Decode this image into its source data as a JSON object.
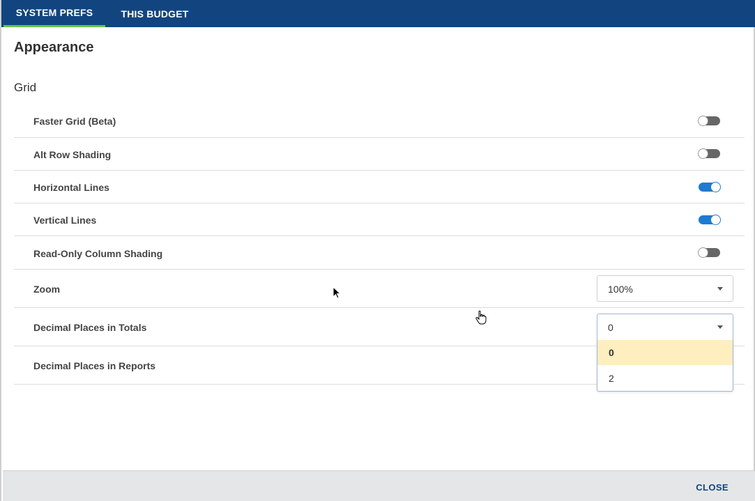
{
  "tabs": [
    {
      "label": "SYSTEM PREFS",
      "active": true
    },
    {
      "label": "THIS BUDGET",
      "active": false
    }
  ],
  "section": {
    "title": "Appearance"
  },
  "group": {
    "title": "Grid"
  },
  "toggles": [
    {
      "label": "Faster Grid (Beta)",
      "on": false
    },
    {
      "label": "Alt Row Shading",
      "on": false
    },
    {
      "label": "Horizontal Lines",
      "on": true
    },
    {
      "label": "Vertical Lines",
      "on": true
    },
    {
      "label": "Read-Only Column Shading",
      "on": false
    }
  ],
  "zoom": {
    "label": "Zoom",
    "value": "100%"
  },
  "decimals_totals": {
    "label": "Decimal Places in Totals",
    "value": "0",
    "options": [
      "0",
      "2"
    ],
    "highlighted": "0"
  },
  "decimals_reports": {
    "label": "Decimal Places in Reports"
  },
  "footer": {
    "close_label": "CLOSE"
  },
  "colors": {
    "header": "#124580",
    "active_tab_underline": "#6cc24a",
    "toggle_on": "#1e7bd2",
    "toggle_off": "#666666",
    "option_highlight": "#ffeec0",
    "footer_bg": "#e5e6e8"
  }
}
